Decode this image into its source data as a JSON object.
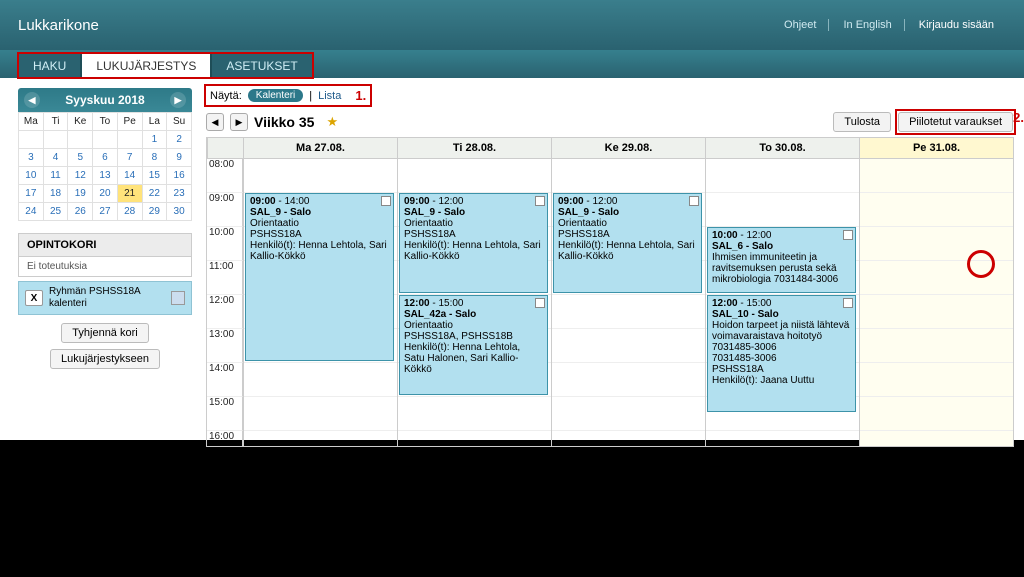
{
  "header": {
    "brand": "Lukkarikone",
    "links": {
      "help": "Ohjeet",
      "english": "In English",
      "login": "Kirjaudu sisään"
    }
  },
  "tabs": {
    "search": "HAKU",
    "schedule": "LUKUJÄRJESTYS",
    "settings": "ASETUKSET"
  },
  "minical": {
    "month": "Syyskuu 2018",
    "dow": [
      "Ma",
      "Ti",
      "Ke",
      "To",
      "Pe",
      "La",
      "Su"
    ],
    "weeks": [
      [
        "",
        "",
        "",
        "",
        "",
        "1",
        "2"
      ],
      [
        "3",
        "4",
        "5",
        "6",
        "7",
        "8",
        "9"
      ],
      [
        "10",
        "11",
        "12",
        "13",
        "14",
        "15",
        "16"
      ],
      [
        "17",
        "18",
        "19",
        "20",
        "21",
        "22",
        "23"
      ],
      [
        "24",
        "25",
        "26",
        "27",
        "28",
        "29",
        "30"
      ]
    ],
    "today": "21"
  },
  "kori": {
    "title": "OPINTOKORI",
    "empty": "Ei toteutuksia",
    "item": "Ryhmän PSHSS18A kalenteri",
    "x": "X",
    "clear": "Tyhjennä kori",
    "add": "Lukujärjestykseen"
  },
  "view": {
    "label": "Näytä:",
    "calendar": "Kalenteri",
    "list": "Lista",
    "sep": "|",
    "annot": "1."
  },
  "weeknav": {
    "title": "Viikko 35",
    "print": "Tulosta",
    "hidden": "Piilotetut varaukset",
    "annot": "2."
  },
  "days": [
    "Ma 27.08.",
    "Ti 28.08.",
    "Ke 29.08.",
    "To 30.08.",
    "Pe 31.08."
  ],
  "hours": [
    "08:00",
    "09:00",
    "10:00",
    "11:00",
    "12:00",
    "13:00",
    "14:00",
    "15:00",
    "16:00"
  ],
  "events": {
    "mon": {
      "time": "09:00 - 14:00",
      "room": "SAL_9 - Salo",
      "l1": "Orientaatio",
      "l2": "PSHSS18A",
      "l3": "Henkilö(t): Henna Lehtola, Sari Kallio-Kökkö"
    },
    "tue1": {
      "time": "09:00 - 12:00",
      "room": "SAL_9 - Salo",
      "l1": "Orientaatio",
      "l2": "PSHSS18A",
      "l3": "Henkilö(t): Henna Lehtola, Sari Kallio-Kökkö"
    },
    "tue2": {
      "time": "12:00 - 15:00",
      "room": "SAL_42a - Salo",
      "l1": "Orientaatio",
      "l2": "PSHSS18A, PSHSS18B",
      "l3": "Henkilö(t): Henna Lehtola, Satu Halonen, Sari Kallio-Kökkö"
    },
    "wed": {
      "time": "09:00 - 12:00",
      "room": "SAL_9 - Salo",
      "l1": "Orientaatio",
      "l2": "PSHSS18A",
      "l3": "Henkilö(t): Henna Lehtola, Sari Kallio-Kökkö"
    },
    "thu1": {
      "time": "10:00 - 12:00",
      "room": "SAL_6 - Salo",
      "l1": "Ihmisen immuniteetin ja ravitsemuksen perusta sekä mikrobiologia 7031484-3006"
    },
    "thu2": {
      "time": "12:00 - 15:00",
      "room": "SAL_10 - Salo",
      "l1": "Hoidon tarpeet ja niistä lähtevä voimavaraistava hoitotyö 7031485-3006",
      "l2": "7031485-3006",
      "l3": "PSHSS18A",
      "l4": "Henkilö(t): Jaana Uuttu"
    }
  }
}
